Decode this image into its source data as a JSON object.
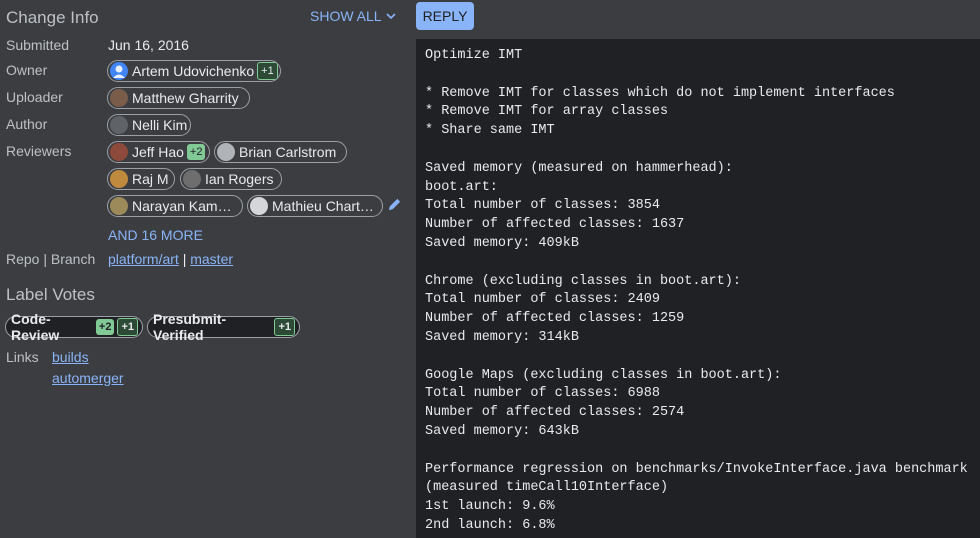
{
  "change_info": {
    "title": "Change Info",
    "show_all": "SHOW ALL",
    "submitted_label": "Submitted",
    "submitted_value": "Jun 16, 2016",
    "owner_label": "Owner",
    "owner": {
      "name": "Artem Udovichenko",
      "vote": "+1"
    },
    "uploader_label": "Uploader",
    "uploader": {
      "name": "Matthew Gharrity"
    },
    "author_label": "Author",
    "author": {
      "name": "Nelli Kim"
    },
    "reviewers_label": "Reviewers",
    "reviewers": [
      {
        "name": "Jeff Hao",
        "vote": "+2"
      },
      {
        "name": "Brian Carlstrom"
      },
      {
        "name": "Raj M"
      },
      {
        "name": "Ian Rogers"
      },
      {
        "name": "Narayan Kam…"
      },
      {
        "name": "Mathieu Chart…"
      }
    ],
    "more_reviewers": "AND 16 MORE",
    "repo_label": "Repo | Branch",
    "repo": "platform/art",
    "repo_sep": "|",
    "branch": "master"
  },
  "label_votes": {
    "title": "Label Votes",
    "labels": [
      {
        "name": "Code-Review",
        "votes": [
          "+2",
          "+1"
        ]
      },
      {
        "name": "Presubmit-Verified",
        "votes": [
          "+1"
        ]
      }
    ]
  },
  "links": {
    "label": "Links",
    "items": [
      "builds",
      "automerger"
    ]
  },
  "reply_button": "REPLY",
  "commit_message": "Optimize IMT\n\n* Remove IMT for classes which do not implement interfaces\n* Remove IMT for array classes\n* Share same IMT\n\nSaved memory (measured on hammerhead):\nboot.art:\nTotal number of classes: 3854\nNumber of affected classes: 1637\nSaved memory: 409kB\n\nChrome (excluding classes in boot.art):\nTotal number of classes: 2409\nNumber of affected classes: 1259\nSaved memory: 314kB\n\nGoogle Maps (excluding classes in boot.art):\nTotal number of classes: 6988\nNumber of affected classes: 2574\nSaved memory: 643kB\n\nPerformance regression on benchmarks/InvokeInterface.java benchmark\n(measured timeCall10Interface)\n1st launch: 9.6%\n2nd launch: 6.8%",
  "colors": {
    "background": "#3b3d40",
    "message_background": "#202124",
    "link": "#8ab4f8",
    "vote_positive": "#81c995"
  }
}
